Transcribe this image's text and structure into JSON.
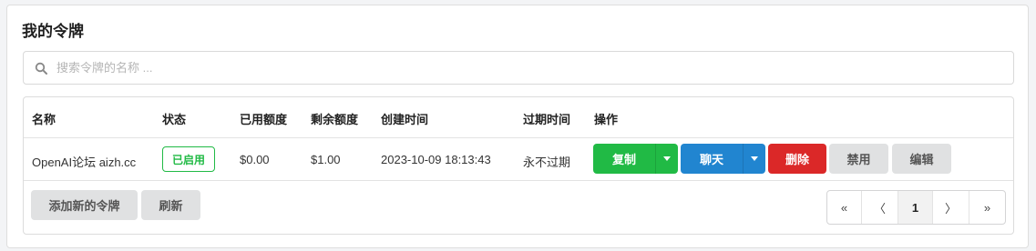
{
  "page": {
    "title": "我的令牌"
  },
  "search": {
    "placeholder": "搜索令牌的名称 ...",
    "value": ""
  },
  "table": {
    "headers": {
      "name": "名称",
      "status": "状态",
      "used": "已用额度",
      "remaining": "剩余额度",
      "created": "创建时间",
      "expires": "过期时间",
      "actions": "操作"
    },
    "rows": [
      {
        "name": "OpenAI论坛 aizh.cc",
        "status": "已启用",
        "used": "$0.00",
        "remaining": "$1.00",
        "created": "2023-10-09 18:13:43",
        "expires": "永不过期"
      }
    ],
    "row_actions": {
      "copy": "复制",
      "chat": "聊天",
      "delete": "删除",
      "disable": "禁用",
      "edit": "编辑"
    }
  },
  "footer": {
    "add_label": "添加新的令牌",
    "refresh_label": "刷新"
  },
  "pagination": {
    "first": "«",
    "prev": "〈",
    "current": "1",
    "next": "〉",
    "last": "»"
  },
  "colors": {
    "green": "#21ba45",
    "blue": "#2185d0",
    "red": "#db2828",
    "grey": "#e0e1e2"
  },
  "icons": {
    "search": "search-icon",
    "dropdown": "caret-down-icon"
  }
}
